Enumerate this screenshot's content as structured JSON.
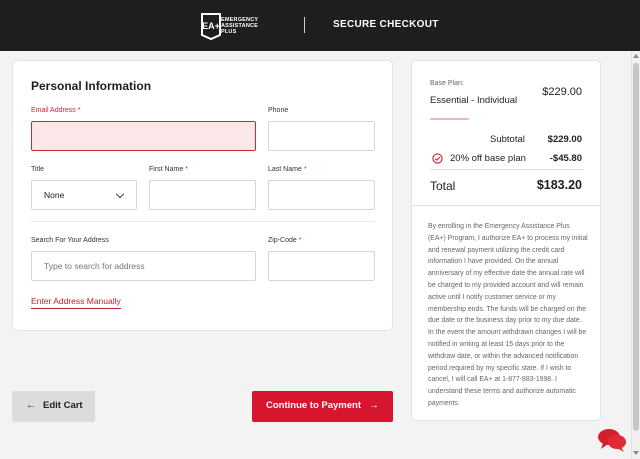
{
  "header": {
    "logo_line1": "EMERGENCY",
    "logo_line2": "ASSISTANCE",
    "logo_line3": "PLUS",
    "logo_badge_text": "EA+",
    "title": "SECURE CHECKOUT"
  },
  "form": {
    "title": "Personal Information",
    "email_label": "Email Address",
    "email_value": "",
    "phone_label": "Phone",
    "phone_value": "",
    "title_label": "Title",
    "title_value": "None",
    "first_name_label": "First Name",
    "first_name_value": "",
    "last_name_label": "Last Name",
    "last_name_value": "",
    "address_label": "Search For Your Address",
    "address_placeholder": "Type to search for address",
    "zip_label": "Zip-Code",
    "zip_value": "",
    "required_mark": "*",
    "manual_link": "Enter Address Manually"
  },
  "actions": {
    "edit_cart": "Edit Cart",
    "continue": "Continue to Payment",
    "back_arrow": "←",
    "forward_arrow": "→"
  },
  "summary": {
    "base_plan_label": "Base Plan:",
    "plan_name": "Essential - Individual",
    "plan_price": "$229.00",
    "subtotal_label": "Subtotal",
    "subtotal_value": "$229.00",
    "discount_label": "20% off base plan",
    "discount_value": "-$45.80",
    "total_label": "Total",
    "total_value": "$183.20",
    "terms": "By enrolling in the Emergency Assistance Plus (EA+) Program, I authorize EA+ to process my initial and renewal payment utilizing the credit card information I have provided. On the annual anniversary of my effective date the annual rate will be charged to my provided account and will remain active until I notify customer service or my membership ends. The funds will be charged on the due date or the business day prior to my due date. In the event the amount withdrawn changes I will be notified in writing at least 15 days prior to the withdraw date, or within the advanced notification period required by my specific state. If I wish to cancel, I will call EA+ at 1-877-883-1998. I understand these terms and authorize automatic payments."
  },
  "icons": {
    "logo": "ea-plus-shield-logo",
    "discount": "check-circle-icon",
    "chat": "chat-bubbles-icon",
    "select": "chevron-down-icon"
  },
  "colors": {
    "header_bg": "#1e1e20",
    "accent_red": "#d6152e",
    "error_bg": "#fbe6e8",
    "page_bg": "#f3f3f3"
  }
}
